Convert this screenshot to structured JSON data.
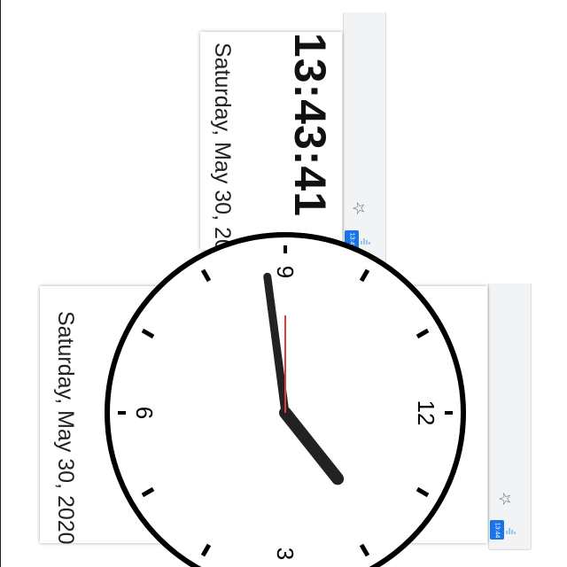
{
  "top_popup": {
    "time": "13:43:41",
    "date": "Saturday, May 30, 2020",
    "extension_badge": "13:43",
    "star_icon": "star-outline-icon",
    "extension_icon": "clock-extension-icon"
  },
  "bottom_popup": {
    "date": "Saturday, May 30, 2020",
    "extension_badge": "13:44",
    "star_icon": "star-outline-icon",
    "extension_icon": "clock-extension-icon",
    "clock": {
      "numerals": {
        "twelve": "12",
        "three": "3",
        "six": "6",
        "nine": "9"
      },
      "time": {
        "hour": 1,
        "minute": 43,
        "second": 45
      }
    }
  },
  "colors": {
    "accent": "#1a73e8",
    "second_hand": "#e53935",
    "hands": "#222222"
  }
}
